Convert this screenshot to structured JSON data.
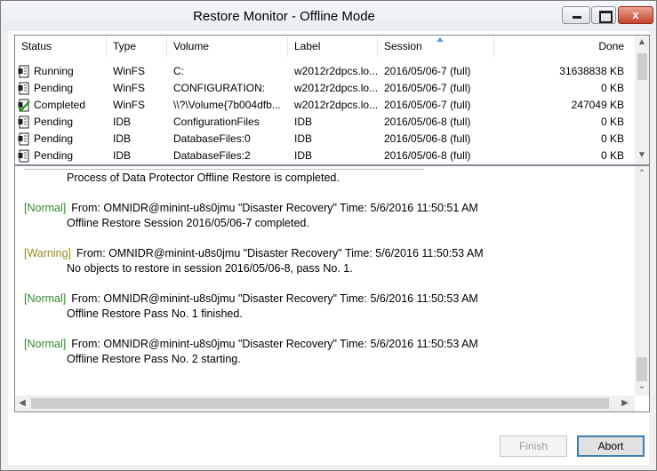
{
  "window": {
    "title": "Restore Monitor - Offline Mode",
    "close_glyph": "x"
  },
  "list": {
    "columns": [
      "Status",
      "Type",
      "Volume",
      "Label",
      "Session",
      "Done"
    ],
    "rows": [
      {
        "status": "Running",
        "icon": "running-status-icon",
        "type": "WinFS",
        "volume": "C:",
        "label": "w2012r2dpcs.lo...",
        "session": "2016/05/06-7  (full)",
        "done": "31638838 KB"
      },
      {
        "status": "Pending",
        "icon": "pending-status-icon",
        "type": "WinFS",
        "volume": "CONFIGURATION:",
        "label": "w2012r2dpcs.lo...",
        "session": "2016/05/06-7  (full)",
        "done": "0 KB"
      },
      {
        "status": "Completed",
        "icon": "completed-status-icon",
        "type": "WinFS",
        "volume": "\\\\?\\Volume{7b004dfb...",
        "label": "w2012r2dpcs.lo...",
        "session": "2016/05/06-7  (full)",
        "done": "247049 KB"
      },
      {
        "status": "Pending",
        "icon": "pending-status-icon",
        "type": "IDB",
        "volume": "ConfigurationFiles",
        "label": "IDB",
        "session": "2016/05/06-8  (full)",
        "done": "0 KB"
      },
      {
        "status": "Pending",
        "icon": "pending-status-icon",
        "type": "IDB",
        "volume": "DatabaseFiles:0",
        "label": "IDB",
        "session": "2016/05/06-8  (full)",
        "done": "0 KB"
      },
      {
        "status": "Pending",
        "icon": "pending-status-icon",
        "type": "IDB",
        "volume": "DatabaseFiles:2",
        "label": "IDB",
        "session": "2016/05/06-8  (full)",
        "done": "0 KB"
      }
    ]
  },
  "log": {
    "entries": [
      {
        "message": "Process of Data Protector Offline Restore is completed."
      },
      {
        "tag": "[Normal]",
        "header": "From: OMNIDR@minint-u8s0jmu \"Disaster Recovery\"  Time: 5/6/2016 11:50:51 AM",
        "message": "Offline Restore Session 2016/05/06-7 completed."
      },
      {
        "tag": "[Warning]",
        "header": "From: OMNIDR@minint-u8s0jmu \"Disaster Recovery\"  Time: 5/6/2016 11:50:53 AM",
        "message": "No objects to restore in session 2016/05/06-8, pass No. 1."
      },
      {
        "tag": "[Normal]",
        "header": "From: OMNIDR@minint-u8s0jmu \"Disaster Recovery\"  Time: 5/6/2016 11:50:53 AM",
        "message": "Offline Restore Pass No. 1 finished."
      },
      {
        "tag": "[Normal]",
        "header": "From: OMNIDR@minint-u8s0jmu \"Disaster Recovery\"  Time: 5/6/2016 11:50:53 AM",
        "message": "Offline Restore Pass No. 2 starting."
      }
    ]
  },
  "buttons": {
    "finish": "Finish",
    "abort": "Abort"
  },
  "colors": {
    "normal_tag": "#2e8b2e",
    "warning_tag": "#9a8a1c",
    "focus_border": "#3c7fb1"
  }
}
